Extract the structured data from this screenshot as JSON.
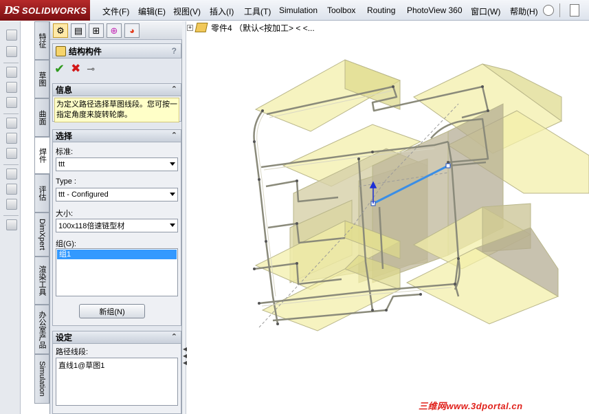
{
  "app": {
    "brand": "SOLIDWORKS",
    "brand_prefix": "DS"
  },
  "menu": [
    "文件(F)",
    "编辑(E)",
    "视图(V)",
    "插入(I)",
    "工具(T)",
    "Simulation",
    "Toolbox",
    "Routing",
    "PhotoView 360",
    "窗口(W)",
    "帮助(H)"
  ],
  "side_tabs": [
    "特征",
    "草图",
    "曲面",
    "焊件",
    "评估",
    "DimXpert",
    "渲染工具",
    "办公室产品",
    "Simulation"
  ],
  "active_tab": "焊件",
  "panel": {
    "title": "结构构件",
    "help": "?",
    "info": {
      "header": "信息",
      "text": "为定义路径选择草图线段。您可按一指定角度来旋转轮廓。"
    },
    "selection": {
      "header": "选择",
      "standard_label": "标准:",
      "standard_value": "ttt",
      "type_label": "Type :",
      "type_value": "ttt - Configured",
      "size_label": "大小:",
      "size_value": "100x118倍速链型材",
      "groups_label": "组(G):",
      "groups": [
        "组1"
      ],
      "new_group_button": "新组(N)"
    },
    "settings": {
      "header": "设定",
      "path_label": "路径线段:",
      "path_items": [
        "直线1@草图1"
      ]
    }
  },
  "tree": {
    "part_label": "零件4 （默认<按加工> < <..."
  },
  "watermark": "三维网www.3dportal.cn",
  "colors": {
    "accent": "#3399ff",
    "profile_fill": "#f2efa8",
    "profile_edge": "#8c8c7c",
    "brand_red": "#b62a2a"
  }
}
